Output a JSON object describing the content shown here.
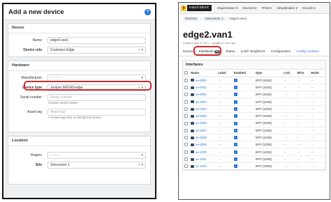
{
  "left": {
    "title": "Add a new device",
    "device": {
      "section": "Device",
      "name_label": "Name",
      "name_value": "edge0.van1",
      "role_label": "Device role",
      "role_value": "Customer Edge"
    },
    "hardware": {
      "section": "Hardware",
      "manufacturer_label": "Manufacturer",
      "manufacturer_value": "---------",
      "type_label": "Device type",
      "type_value": "Juniper MX240-edge",
      "serial_label": "Serial number",
      "serial_placeholder": "Serial number",
      "serial_hint": "Chassis serial number",
      "asset_label": "Asset tag",
      "asset_placeholder": "Asset tag",
      "asset_hint": "A unique tag used to identify this device"
    },
    "location": {
      "section": "Location",
      "region_label": "Region",
      "region_value": "---------",
      "site_label": "Site",
      "site_value": "Vancouver 1"
    }
  },
  "right": {
    "logo_mark": "⋕",
    "logo_text": "nautobot",
    "menu": [
      "Organization",
      "Devices",
      "IPAM",
      "Virtualization",
      "Circuits"
    ],
    "breadcrumbs": [
      "Devices",
      "Vancouver 1",
      "edge2.van1"
    ],
    "device_name": "edge2.van1",
    "meta": "Created June 8, 2021 · Updated 1 hour ago",
    "tabs": [
      "Device",
      "Interfaces",
      "Status",
      "LLDP Neighbors",
      "Configuration",
      "Config Context"
    ],
    "interface_count": "26",
    "interfaces_heading": "Interfaces",
    "columns": [
      "Name",
      "Label",
      "Enabled",
      "Type",
      "LAG",
      "MTU",
      "Mode"
    ],
    "rows": [
      {
        "name": "xe-0/0/0",
        "type": "SFP (10GE)"
      },
      {
        "name": "xe-0/0/1",
        "type": "SFP (10GE)"
      },
      {
        "name": "xe-0/0/2",
        "type": "SFP (10GE)"
      },
      {
        "name": "xe-0/0/3",
        "type": "SFP (10GE)"
      },
      {
        "name": "xe-0/0/4",
        "type": "SFP (10GE)"
      },
      {
        "name": "xe-0/0/5",
        "type": "SFP (10GE)"
      },
      {
        "name": "xe-0/0/6",
        "type": "SFP (10GE)"
      },
      {
        "name": "xe-0/0/7",
        "type": "SFP (10GE)"
      },
      {
        "name": "xe-0/0/8",
        "type": "SFP (10GE)"
      },
      {
        "name": "xe-0/0/9",
        "type": "SFP (10GE)"
      },
      {
        "name": "xe-1/0/0",
        "type": "SFP (10GE)"
      },
      {
        "name": "xe-1/0/1",
        "type": "SFP (10GE)"
      },
      {
        "name": "xe-1/0/2",
        "type": "SFP (10GE)"
      }
    ],
    "dash": "—"
  },
  "colors": {
    "highlight": "#d42a2a",
    "link": "#1f6fd1",
    "logo_yellow": "#ffcc33"
  }
}
